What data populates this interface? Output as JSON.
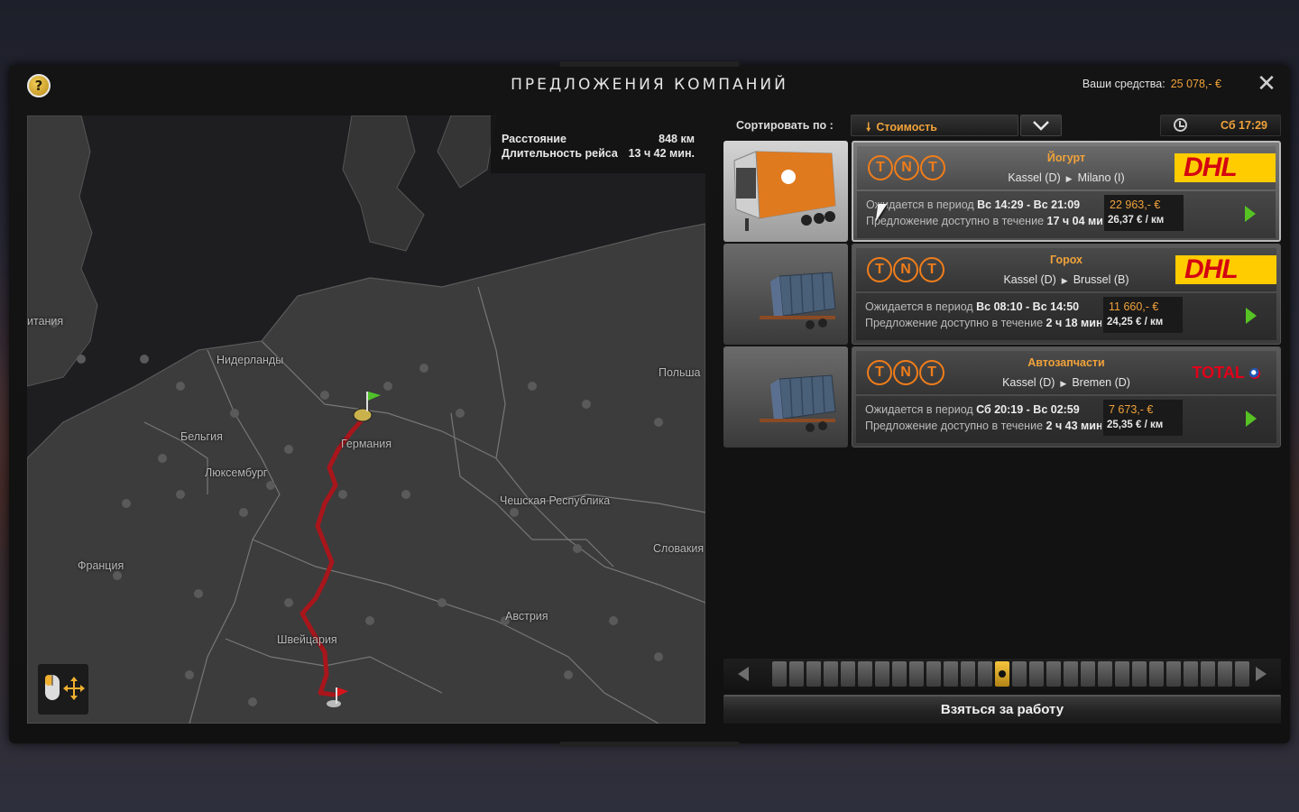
{
  "window": {
    "title": "ПРЕДЛОЖЕНИЯ КОМПАНИЙ",
    "help_icon": "?",
    "close_icon": "✕",
    "funds_label": "Ваши средства:",
    "funds_value": "25 078,- €"
  },
  "map": {
    "route_info": {
      "distance_label": "Расстояние",
      "distance_value": "848 км",
      "duration_label": "Длительность рейса",
      "duration_value": "13 ч 42 мин."
    },
    "labels": {
      "britain": "итания",
      "netherlands": "Нидерланды",
      "belgium": "Бельгия",
      "luxembourg": "Люксембург",
      "germany": "Германия",
      "poland": "Польша",
      "czech": "Чешская Республика",
      "slovakia": "Словакия",
      "france": "Франция",
      "austria": "Австрия",
      "switzerland": "Швейцария"
    },
    "route_color": "#a8161b",
    "start_flag_color": "#4fc12a",
    "end_flag_color": "#d8141a"
  },
  "sort": {
    "label": "Сортировать по :",
    "selected": "Стоимость",
    "toggle_icon": "chevron-down-icon"
  },
  "clock": {
    "time": "Сб 17:29"
  },
  "offers": [
    {
      "cargo": "Йогурт",
      "from": "Kassel (D)",
      "to": "Milano (I)",
      "sender_logo": "TNT",
      "receiver_logo": "DHL",
      "window_label": "Ожидается в период",
      "window_value": "Вс 14:29 - Вс 21:09",
      "avail_label": "Предложение доступно в течение",
      "avail_value": "17 ч 04 мин",
      "price": "22 963,- €",
      "per_km": "26,37 € / км",
      "trailer": "reefer"
    },
    {
      "cargo": "Горох",
      "from": "Kassel (D)",
      "to": "Brussel (B)",
      "sender_logo": "TNT",
      "receiver_logo": "DHL",
      "window_label": "Ожидается в период",
      "window_value": "Вс 08:10 - Вс 14:50",
      "avail_label": "Предложение доступно в течение",
      "avail_value": "2 ч 18 мин",
      "price": "11 660,- €",
      "per_km": "24,25 € / км",
      "trailer": "container"
    },
    {
      "cargo": "Автозапчасти",
      "from": "Kassel (D)",
      "to": "Bremen (D)",
      "sender_logo": "TNT",
      "receiver_logo": "TOTAL",
      "window_label": "Ожидается в период",
      "window_value": "Сб 20:19 - Вс 02:59",
      "avail_label": "Предложение доступно в течение",
      "avail_value": "2 ч 43 мин",
      "price": "7 673,- €",
      "per_km": "25,35 € / км",
      "trailer": "container"
    }
  ],
  "pager": {
    "total_pages": 28,
    "current_page": 14
  },
  "actions": {
    "take_job": "Взяться за работу"
  }
}
